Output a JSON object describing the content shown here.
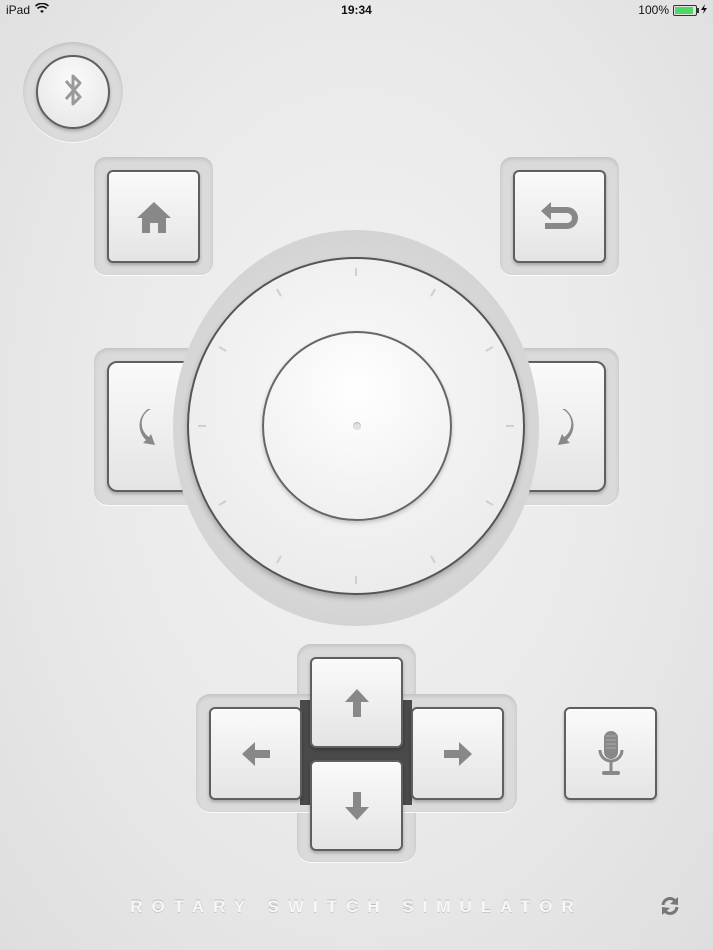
{
  "status_bar": {
    "device": "iPad",
    "time": "19:34",
    "battery": "100%",
    "battery_level": 1.0
  },
  "app": {
    "title": "ROTARY SWITCH SIMULATOR"
  },
  "buttons": {
    "bluetooth": "bluetooth-icon",
    "home": "home-icon",
    "back": "back-icon",
    "rotate_left": "rotate-counterclockwise-icon",
    "rotate_right": "rotate-clockwise-icon",
    "up": "arrow-up-icon",
    "down": "arrow-down-icon",
    "left": "arrow-left-icon",
    "right": "arrow-right-icon",
    "microphone": "microphone-icon",
    "refresh": "refresh-icon"
  },
  "colors": {
    "icon": "#888888",
    "key_border": "#5f5f5f",
    "background": "#e9e9e9",
    "battery": "#4cd964"
  }
}
